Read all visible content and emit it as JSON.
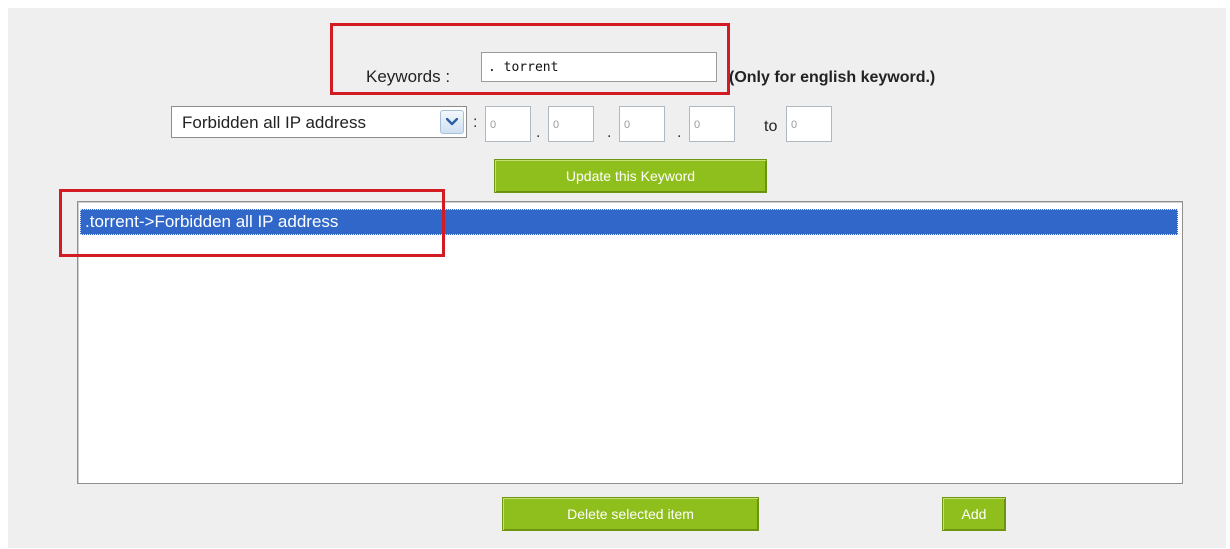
{
  "keyword": {
    "label": "Keywords :",
    "value": ". torrent",
    "note": "(Only for english keyword.)"
  },
  "ip": {
    "select_value": "Forbidden all IP address",
    "colon": ":",
    "octets": [
      "0",
      "0",
      "0",
      "0"
    ],
    "dot": ".",
    "to_label": "to",
    "end_value": "0"
  },
  "buttons": {
    "update": "Update this Keyword",
    "delete": "Delete selected item",
    "add": "Add"
  },
  "list": {
    "items": [
      ".torrent->Forbidden all IP address"
    ],
    "selected_index": 0
  },
  "colors": {
    "button_green": "#8fbf1c",
    "selection_blue": "#3167c8",
    "highlight_red": "#d21b22",
    "panel_bg": "#efefef"
  },
  "icons": {
    "select_arrow": "chevron-down-icon"
  }
}
